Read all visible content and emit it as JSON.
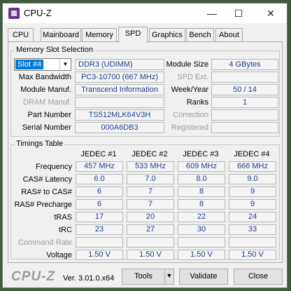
{
  "titlebar": {
    "title": "CPU-Z",
    "minimize": "—",
    "maximize": "☐",
    "close": "✕"
  },
  "tabs": [
    "CPU",
    "Mainboard",
    "Memory",
    "SPD",
    "Graphics",
    "Bench",
    "About"
  ],
  "memory_slot": {
    "group_label": "Memory Slot Selection",
    "slot_value": "Slot #4",
    "type": "DDR3 (UDIMM)",
    "module_size_label": "Module Size",
    "module_size": "4 GBytes",
    "max_bandwidth_label": "Max Bandwidth",
    "max_bandwidth": "PC3-10700 (667 MHz)",
    "spd_ext_label": "SPD Ext.",
    "spd_ext": "",
    "manuf_label": "Module Manuf.",
    "manuf": "Transcend Information",
    "week_year_label": "Week/Year",
    "week_year": "50 / 14",
    "dram_manuf_label": "DRAM Manuf.",
    "dram_manuf": "",
    "ranks_label": "Ranks",
    "ranks": "1",
    "part_label": "Part Number",
    "part": "TS512MLK64V3H",
    "correction_label": "Correction",
    "correction": "",
    "serial_label": "Serial Number",
    "serial": "000A6DB3",
    "registered_label": "Registered",
    "registered": ""
  },
  "timings": {
    "group_label": "Timings Table",
    "columns": [
      "JEDEC #1",
      "JEDEC #2",
      "JEDEC #3",
      "JEDEC #4"
    ],
    "rows": [
      {
        "label": "Frequency",
        "values": [
          "457 MHz",
          "533 MHz",
          "609 MHz",
          "666 MHz"
        ],
        "dim": false
      },
      {
        "label": "CAS# Latency",
        "values": [
          "6.0",
          "7.0",
          "8.0",
          "9.0"
        ],
        "dim": false
      },
      {
        "label": "RAS# to CAS#",
        "values": [
          "6",
          "7",
          "8",
          "9"
        ],
        "dim": false
      },
      {
        "label": "RAS# Precharge",
        "values": [
          "6",
          "7",
          "8",
          "9"
        ],
        "dim": false
      },
      {
        "label": "tRAS",
        "values": [
          "17",
          "20",
          "22",
          "24"
        ],
        "dim": false
      },
      {
        "label": "tRC",
        "values": [
          "23",
          "27",
          "30",
          "33"
        ],
        "dim": false
      },
      {
        "label": "Command Rate",
        "values": [
          "",
          "",
          "",
          ""
        ],
        "dim": true
      },
      {
        "label": "Voltage",
        "values": [
          "1.50 V",
          "1.50 V",
          "1.50 V",
          "1.50 V"
        ],
        "dim": false
      }
    ]
  },
  "footer": {
    "brand": "CPU-Z",
    "version": "Ver. 3.01.0.x64",
    "tools": "Tools",
    "validate": "Validate",
    "close": "Close"
  }
}
